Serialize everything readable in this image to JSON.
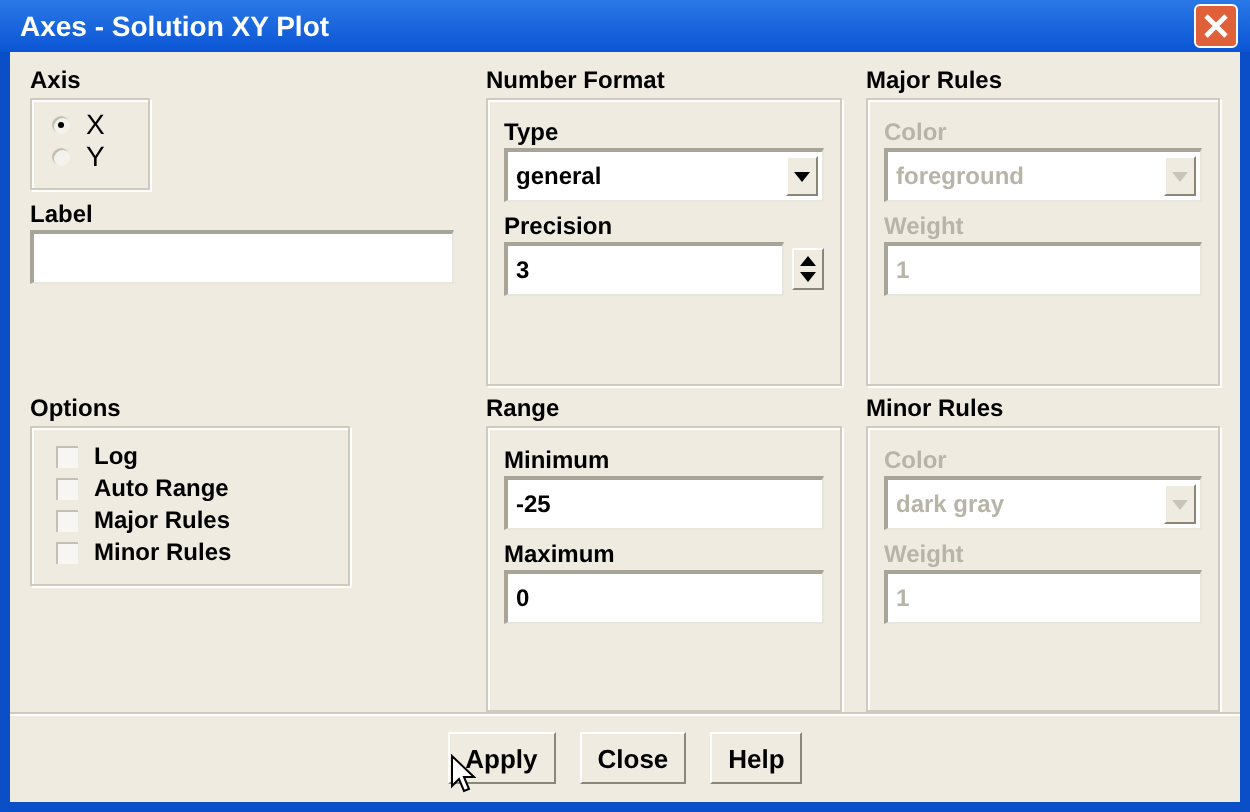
{
  "window": {
    "title": "Axes - Solution XY Plot"
  },
  "axis": {
    "label": "Axis",
    "options": [
      {
        "label": "X",
        "selected": true
      },
      {
        "label": "Y",
        "selected": false
      }
    ]
  },
  "label_field": {
    "label": "Label"
  },
  "options": {
    "label": "Options",
    "items": [
      {
        "label": "Log",
        "checked": false
      },
      {
        "label": "Auto Range",
        "checked": false
      },
      {
        "label": "Major Rules",
        "checked": false
      },
      {
        "label": "Minor Rules",
        "checked": false
      }
    ]
  },
  "number_format": {
    "label": "Number Format",
    "type": {
      "label": "Type",
      "value": "general"
    },
    "precision": {
      "label": "Precision",
      "value": "3"
    }
  },
  "range": {
    "label": "Range",
    "minimum": {
      "label": "Minimum",
      "value": "-25"
    },
    "maximum": {
      "label": "Maximum",
      "value": "0"
    }
  },
  "major_rules": {
    "label": "Major Rules",
    "disabled": true,
    "color": {
      "label": "Color",
      "value": "foreground"
    },
    "weight": {
      "label": "Weight",
      "value": "1"
    }
  },
  "minor_rules": {
    "label": "Minor Rules",
    "disabled": true,
    "color": {
      "label": "Color",
      "value": "dark gray"
    },
    "weight": {
      "label": "Weight",
      "value": "1"
    }
  },
  "buttons": [
    {
      "label": "Apply"
    },
    {
      "label": "Close"
    },
    {
      "label": "Help"
    }
  ]
}
